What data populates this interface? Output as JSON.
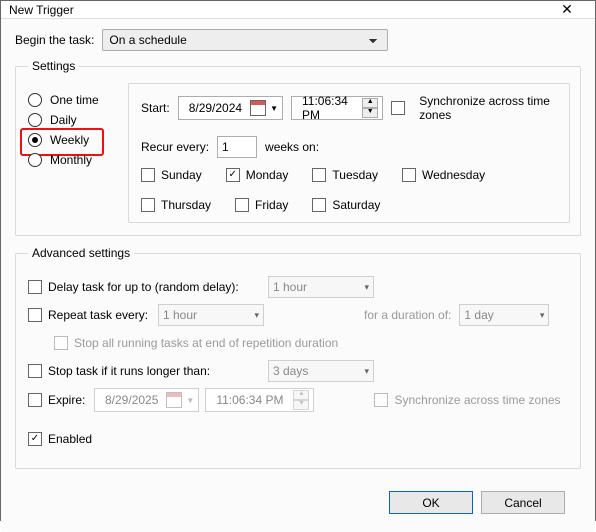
{
  "window": {
    "title": "New Trigger"
  },
  "begin": {
    "label": "Begin the task:",
    "value": "On a schedule"
  },
  "settings": {
    "legend": "Settings",
    "schedule": {
      "options": [
        "One time",
        "Daily",
        "Weekly",
        "Monthly"
      ],
      "selected": "Weekly"
    },
    "start": {
      "label": "Start:",
      "date": "8/29/2024",
      "time": "11:06:34 PM",
      "sync_label": "Synchronize across time zones",
      "sync": false
    },
    "recur": {
      "label_prefix": "Recur every:",
      "value": "1",
      "label_suffix": "weeks on:"
    },
    "days": [
      {
        "label": "Sunday",
        "checked": false
      },
      {
        "label": "Monday",
        "checked": true
      },
      {
        "label": "Tuesday",
        "checked": false
      },
      {
        "label": "Wednesday",
        "checked": false
      },
      {
        "label": "Thursday",
        "checked": false
      },
      {
        "label": "Friday",
        "checked": false
      },
      {
        "label": "Saturday",
        "checked": false
      }
    ]
  },
  "advanced": {
    "legend": "Advanced settings",
    "delay": {
      "label": "Delay task for up to (random delay):",
      "checked": false,
      "value": "1 hour"
    },
    "repeat": {
      "label": "Repeat task every:",
      "checked": false,
      "value": "1 hour",
      "duration_label": "for a duration of:",
      "duration_value": "1 day"
    },
    "stop_repeat": {
      "label": "Stop all running tasks at end of repetition duration",
      "checked": false
    },
    "stop_if": {
      "label": "Stop task if it runs longer than:",
      "checked": false,
      "value": "3 days"
    },
    "expire": {
      "label": "Expire:",
      "checked": false,
      "date": "8/29/2025",
      "time": "11:06:34 PM",
      "sync_label": "Synchronize across time zones",
      "sync": false
    },
    "enabled": {
      "label": "Enabled",
      "checked": true
    }
  },
  "buttons": {
    "ok": "OK",
    "cancel": "Cancel"
  }
}
